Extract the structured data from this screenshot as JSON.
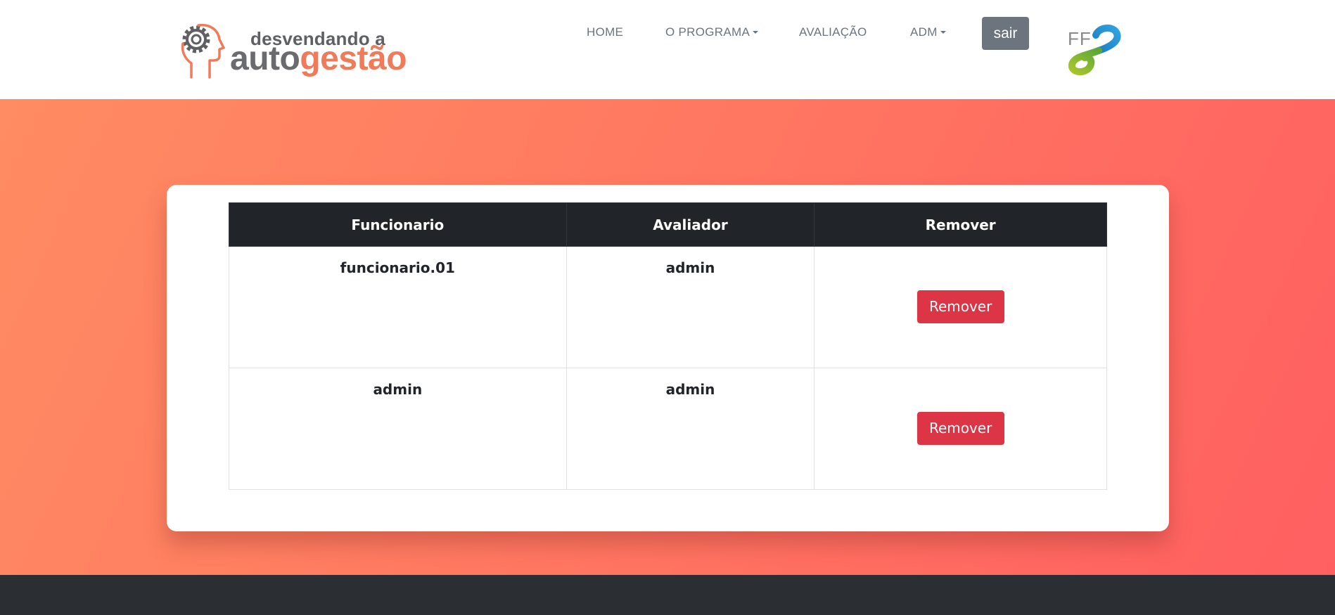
{
  "header": {
    "logo": {
      "line1": "desvendando a",
      "line2_part1": "auto",
      "line2_part2": "gestão"
    },
    "nav": {
      "home": "HOME",
      "programa": "O PROGRAMA",
      "avaliacao": "AVALIAÇÃO",
      "adm": "ADM"
    },
    "sair_label": "sair",
    "partner_logo_text": "FF"
  },
  "table": {
    "columns": [
      "Funcionario",
      "Avaliador",
      "Remover"
    ],
    "rows": [
      {
        "funcionario": "funcionario.01",
        "avaliador": "admin",
        "action": "Remover"
      },
      {
        "funcionario": "admin",
        "avaliador": "admin",
        "action": "Remover"
      }
    ]
  },
  "colors": {
    "accent_orange": "#f07b5b",
    "danger": "#dc3545",
    "secondary": "#6c757d",
    "dark": "#212529",
    "gradient_start": "#ff8c62",
    "gradient_end": "#ff5f61",
    "footer": "#2b2f33"
  }
}
